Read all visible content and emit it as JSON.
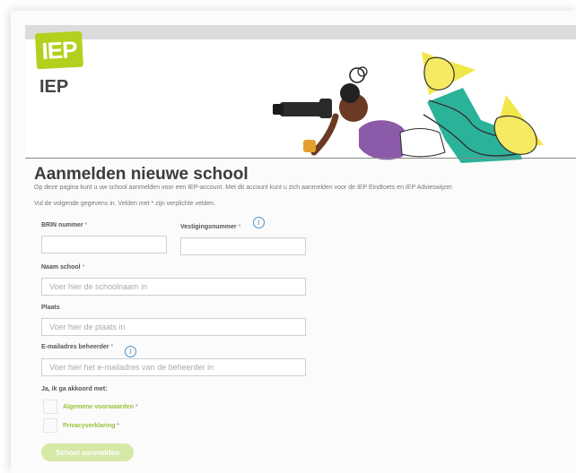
{
  "header": {
    "logo_text": "IEP",
    "brand_name": "IEP"
  },
  "page": {
    "title": "Aanmelden nieuwe school",
    "intro": "Op deze pagina kunt u uw school aanmelden voor een IEP-account. Met dit account kunt u zich aanmelden voor de IEP Eindtoets en IEP Advieswijzer.",
    "instructions": "Vul de volgende gegevens in. Velden met * zijn verplichte velden."
  },
  "form": {
    "brin": {
      "label": "BRIN nummer",
      "required_mark": "*",
      "value": "",
      "placeholder": ""
    },
    "vestiging": {
      "label": "Vestigingsnummer",
      "required_mark": "*",
      "value": "",
      "placeholder": ""
    },
    "naam": {
      "label": "Naam school",
      "required_mark": "*",
      "placeholder": "Voer hier de schoolnaam in"
    },
    "plaats": {
      "label": "Plaats",
      "placeholder": "Voer hier de plaats in"
    },
    "email": {
      "label": "E-mailadres beheerder",
      "required_mark": "*",
      "placeholder": "Voer hier het e-mailadres van de beheerder in"
    },
    "agree_heading": "Ja, ik ga akkoord met:",
    "terms": {
      "label": "Algemene voorwaarden",
      "required_mark": "*",
      "checked": false
    },
    "privacy": {
      "label": "Privacyverklaring",
      "required_mark": "*",
      "checked": false
    },
    "submit_label": "School aanmelden",
    "info_icon_glyph": "i"
  },
  "colors": {
    "brand_green": "#b5cf1f",
    "link_green": "#9cc23a",
    "button_disabled": "#d6e8a6",
    "info_blue": "#4a90c8",
    "hero_yellow": "#f2e74a",
    "hero_teal": "#2bb39a"
  }
}
